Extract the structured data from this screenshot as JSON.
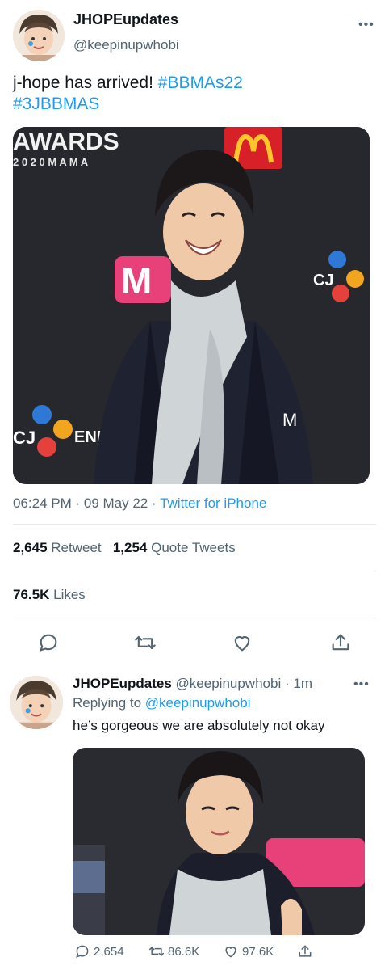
{
  "tweet": {
    "author_name": "JHOPEupdates",
    "author_handle": "@keepinupwhobi",
    "more_icon": "•••",
    "text_plain": "j-hope has arrived! ",
    "hashtag_1": "#BBMAs22",
    "hashtag_2": "#3JBBMAS",
    "media": {
      "backdrop_text_awards": "AWARDS",
      "backdrop_text_mama": "2 0 2 0  M A M A",
      "backdrop_text_cj": "CJ",
      "backdrop_text_enm": "ENM",
      "backdrop_text_m": "M"
    },
    "time": "06:24 PM",
    "date": "09 May 22",
    "source": "Twitter for iPhone",
    "retweets_count": "2,645",
    "retweets_label": "Retweet",
    "quotes_count": "1,254",
    "quotes_label": "Quote Tweets",
    "likes_count": "76.5K",
    "likes_label": "Likes"
  },
  "reply": {
    "author_name": "JHOPEupdates",
    "author_handle": "@keepinupwhobi",
    "age": "1m",
    "replying_to_label": "Replying to",
    "replying_to_handle": "@keepinupwhobi",
    "text": "he’s gorgeous we are absolutely not okay",
    "replies_count": "2,654",
    "retweets_count": "86.6K",
    "likes_count": "97.6K"
  },
  "colors": {
    "link": "#1d9bf0",
    "muted": "#536471",
    "text": "#0f1419",
    "divider": "#e6e9ec"
  },
  "icons": [
    "more-icon",
    "reply-icon",
    "retweet-icon",
    "like-icon",
    "share-icon"
  ]
}
